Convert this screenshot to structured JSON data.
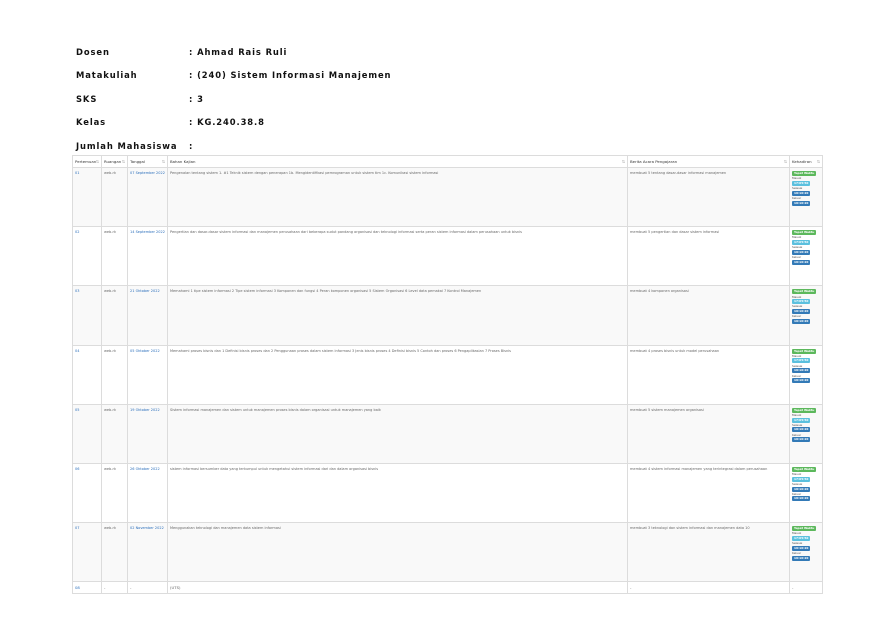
{
  "info": [
    {
      "key": "Dosen",
      "value": ": Ahmad Rais Ruli"
    },
    {
      "key": "Matakuliah",
      "value": ": (240) Sistem Informasi Manajemen"
    },
    {
      "key": "SKS",
      "value": ": 3"
    },
    {
      "key": "Kelas",
      "value": ": KG.240.38.8"
    },
    {
      "key": "Jumlah Mahasiswa",
      "value": ":"
    }
  ],
  "table": {
    "headers": [
      "Pertemuan",
      "Ruangan",
      "Tanggal",
      "Bahan Kajian",
      "Berita Acara Pengajaran",
      "Kehadiran"
    ],
    "badges": {
      "start_label": "Tepat Waktu",
      "masuk_label": "Masuk",
      "masuk_time": "17:05:50",
      "selesai_label": "Selesai",
      "keluar_label": "Keluar",
      "keluar_time": "19:10:20"
    },
    "rows": [
      {
        "no": "01",
        "room": "web-rk",
        "date": "07 September 2022",
        "topic": "Pengenalan tentang sistem 1. #1 Teknik sistem dengan penerapan 1b. Mengidentifikasi pemrograman untuk sistem tim 1c. Komunikasi sistem informasi",
        "news": "membuat 5 tentang dasar-dasar informasi manajemen",
        "masuk_time": "17:05:50",
        "keluar_time": "19:10:20"
      },
      {
        "no": "02",
        "room": "web-rk",
        "date": "14 September 2022",
        "topic": "Pengertian dan dasar-dasar sistem informasi dan manajemen perusahaan dari beberapa sudut pandang organisasi dan teknologi informasi serta peran sistem informasi dalam perusahaan untuk bisnis",
        "news": "membuat 5 pengertian dan dasar sistem informasi",
        "masuk_time": "17:05:50",
        "keluar_time": "19:10:20"
      },
      {
        "no": "03",
        "room": "web-rk",
        "date": "21 Oktober 2022",
        "topic": "Memahami 1 tipe sistem informasi 2 Tipe sistem informasi 3 Komponen dan fungsi 4 Peran komponen organisasi 5 Sistem Organisasi 6 Level data pemakai 7 Kontrol Manajemen",
        "news": "membuat 4 komponen organisasi",
        "masuk_time": "17:05:50",
        "keluar_time": "19:10:20"
      },
      {
        "no": "04",
        "room": "web-rk",
        "date": "05 Oktober 2022",
        "topic": "Memahami proses bisnis dan 1 Definisi bisnis proses dan 2 Penggunaan proses dalam sistem informasi 3 Jenis bisnis proses 4 Definisi bisnis 5 Contoh dan proses 6 Pengaplikasian 7 Proses Bisnis",
        "news": "membuat 4 proses bisnis untuk model perusahaan",
        "masuk_time": "17:05:50",
        "keluar_time": "19:10:20"
      },
      {
        "no": "05",
        "room": "web-rk",
        "date": "19 Oktober 2022",
        "topic": "Sistem informasi manajemen dan sistem untuk manajemen proses bisnis dalam organisasi untuk manajemen yang baik",
        "news": "membuat 5 sistem manajemen organisasi",
        "masuk_time": "17:05:50",
        "keluar_time": "19:10:20"
      },
      {
        "no": "06",
        "room": "web-rk",
        "date": "26 Oktober 2022",
        "topic": "sistem informasi bersumber data yang terkumpul untuk mengetahui sistem informasi dari dan dalam organisasi bisnis",
        "news": "membuat 4 sistem informasi manajemen yang terintegrasi dalam perusahaan",
        "masuk_time": "17:05:50",
        "keluar_time": "19:10:20"
      },
      {
        "no": "07",
        "room": "web-rk",
        "date": "02 November 2022",
        "topic": "Menggunakan teknologi dan manajemen data sistem informasi",
        "news": "membuat 3 teknologi dan sistem informasi dan manajemen data 10",
        "masuk_time": "17:05:50",
        "keluar_time": "19:10:20"
      }
    ],
    "footer": {
      "no": "08",
      "room": "-",
      "date": "-",
      "topic": "(UTS)",
      "news": "-",
      "attendance": "-"
    }
  }
}
